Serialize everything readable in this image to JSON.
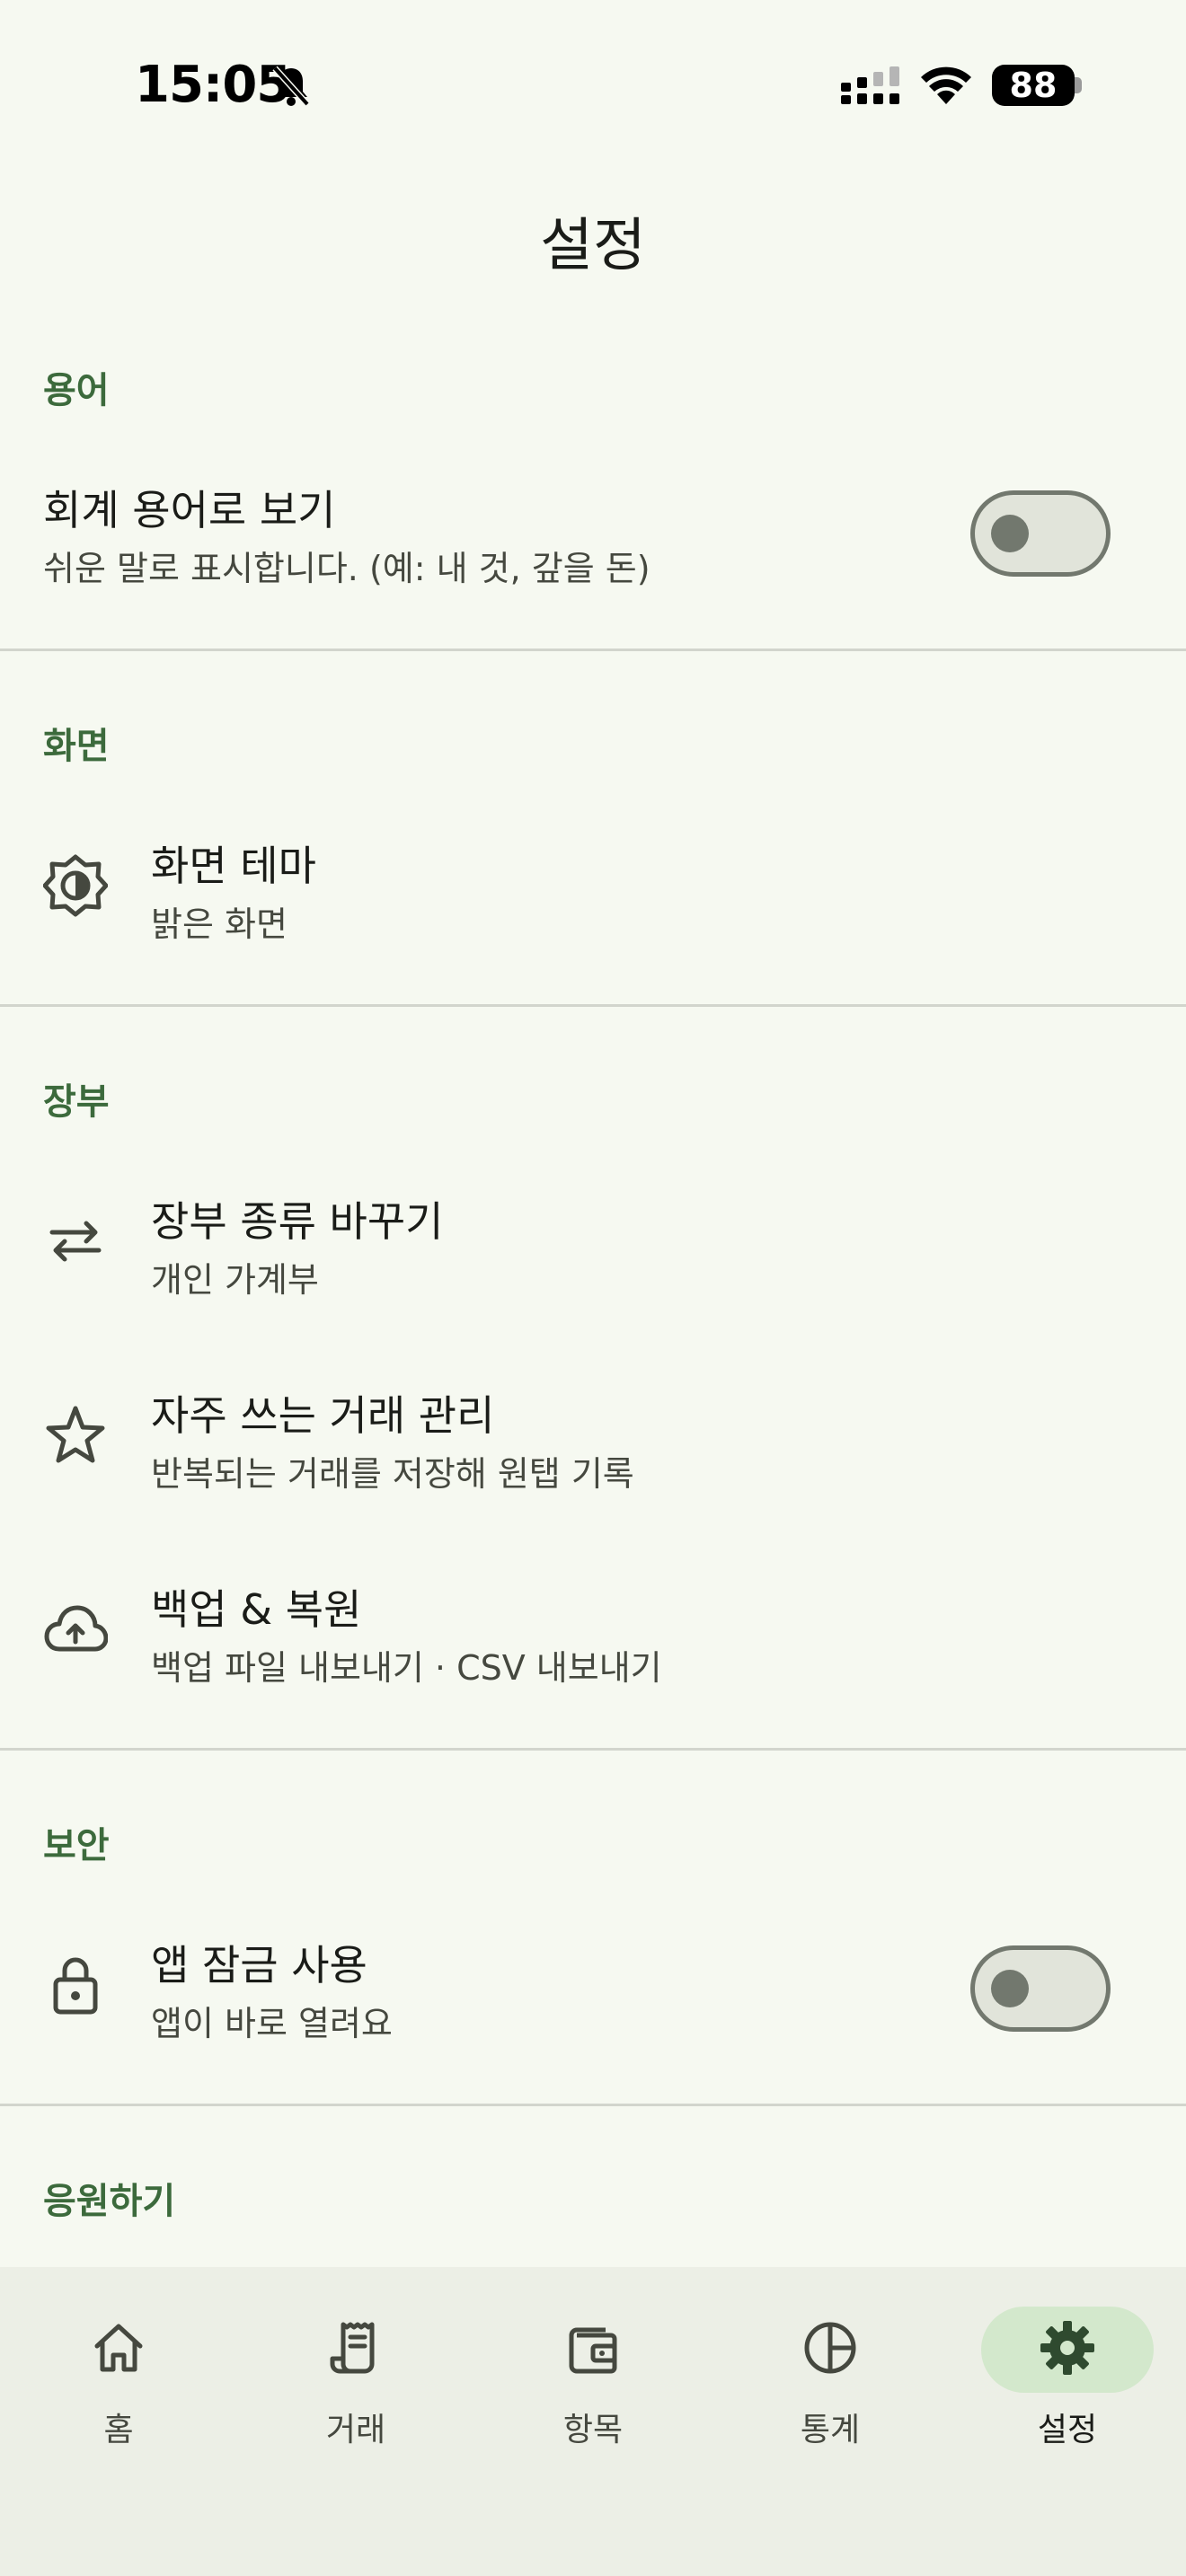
{
  "status_bar": {
    "time": "15:05",
    "battery": "88"
  },
  "header": {
    "title": "설정"
  },
  "sections": {
    "terms": {
      "title": "용어",
      "accounting_terms": {
        "title": "회계 용어로 보기",
        "subtitle": "쉬운 말로 표시합니다. (예: 내 것, 갚을 돈)",
        "enabled": false
      }
    },
    "display": {
      "title": "화면",
      "theme": {
        "title": "화면 테마",
        "subtitle": "밝은 화면",
        "icon": "brightness-icon"
      }
    },
    "ledger": {
      "title": "장부",
      "switch_ledger": {
        "title": "장부 종류 바꾸기",
        "subtitle": "개인 가계부",
        "icon": "swap-arrows-icon"
      },
      "favorites": {
        "title": "자주 쓰는 거래 관리",
        "subtitle": "반복되는 거래를 저장해 원탭 기록",
        "icon": "star-icon"
      },
      "backup": {
        "title": "백업 & 복원",
        "subtitle": "백업 파일 내보내기 · CSV 내보내기",
        "icon": "cloud-upload-icon"
      }
    },
    "security": {
      "title": "보안",
      "app_lock": {
        "title": "앱 잠금 사용",
        "subtitle": "앱이 바로 열려요",
        "icon": "lock-icon",
        "enabled": false
      }
    },
    "support": {
      "title": "응원하기"
    }
  },
  "bottom_nav": {
    "items": [
      {
        "label": "홈",
        "icon": "home-icon"
      },
      {
        "label": "거래",
        "icon": "receipt-icon"
      },
      {
        "label": "항목",
        "icon": "wallet-icon"
      },
      {
        "label": "통계",
        "icon": "pie-chart-icon"
      },
      {
        "label": "설정",
        "icon": "gear-icon"
      }
    ],
    "active": "설정"
  },
  "colors": {
    "background": "#f6f9f1",
    "accent": "#3c6a3c",
    "nav_background": "#ecefe6",
    "active_pill": "#d3e8cc"
  }
}
